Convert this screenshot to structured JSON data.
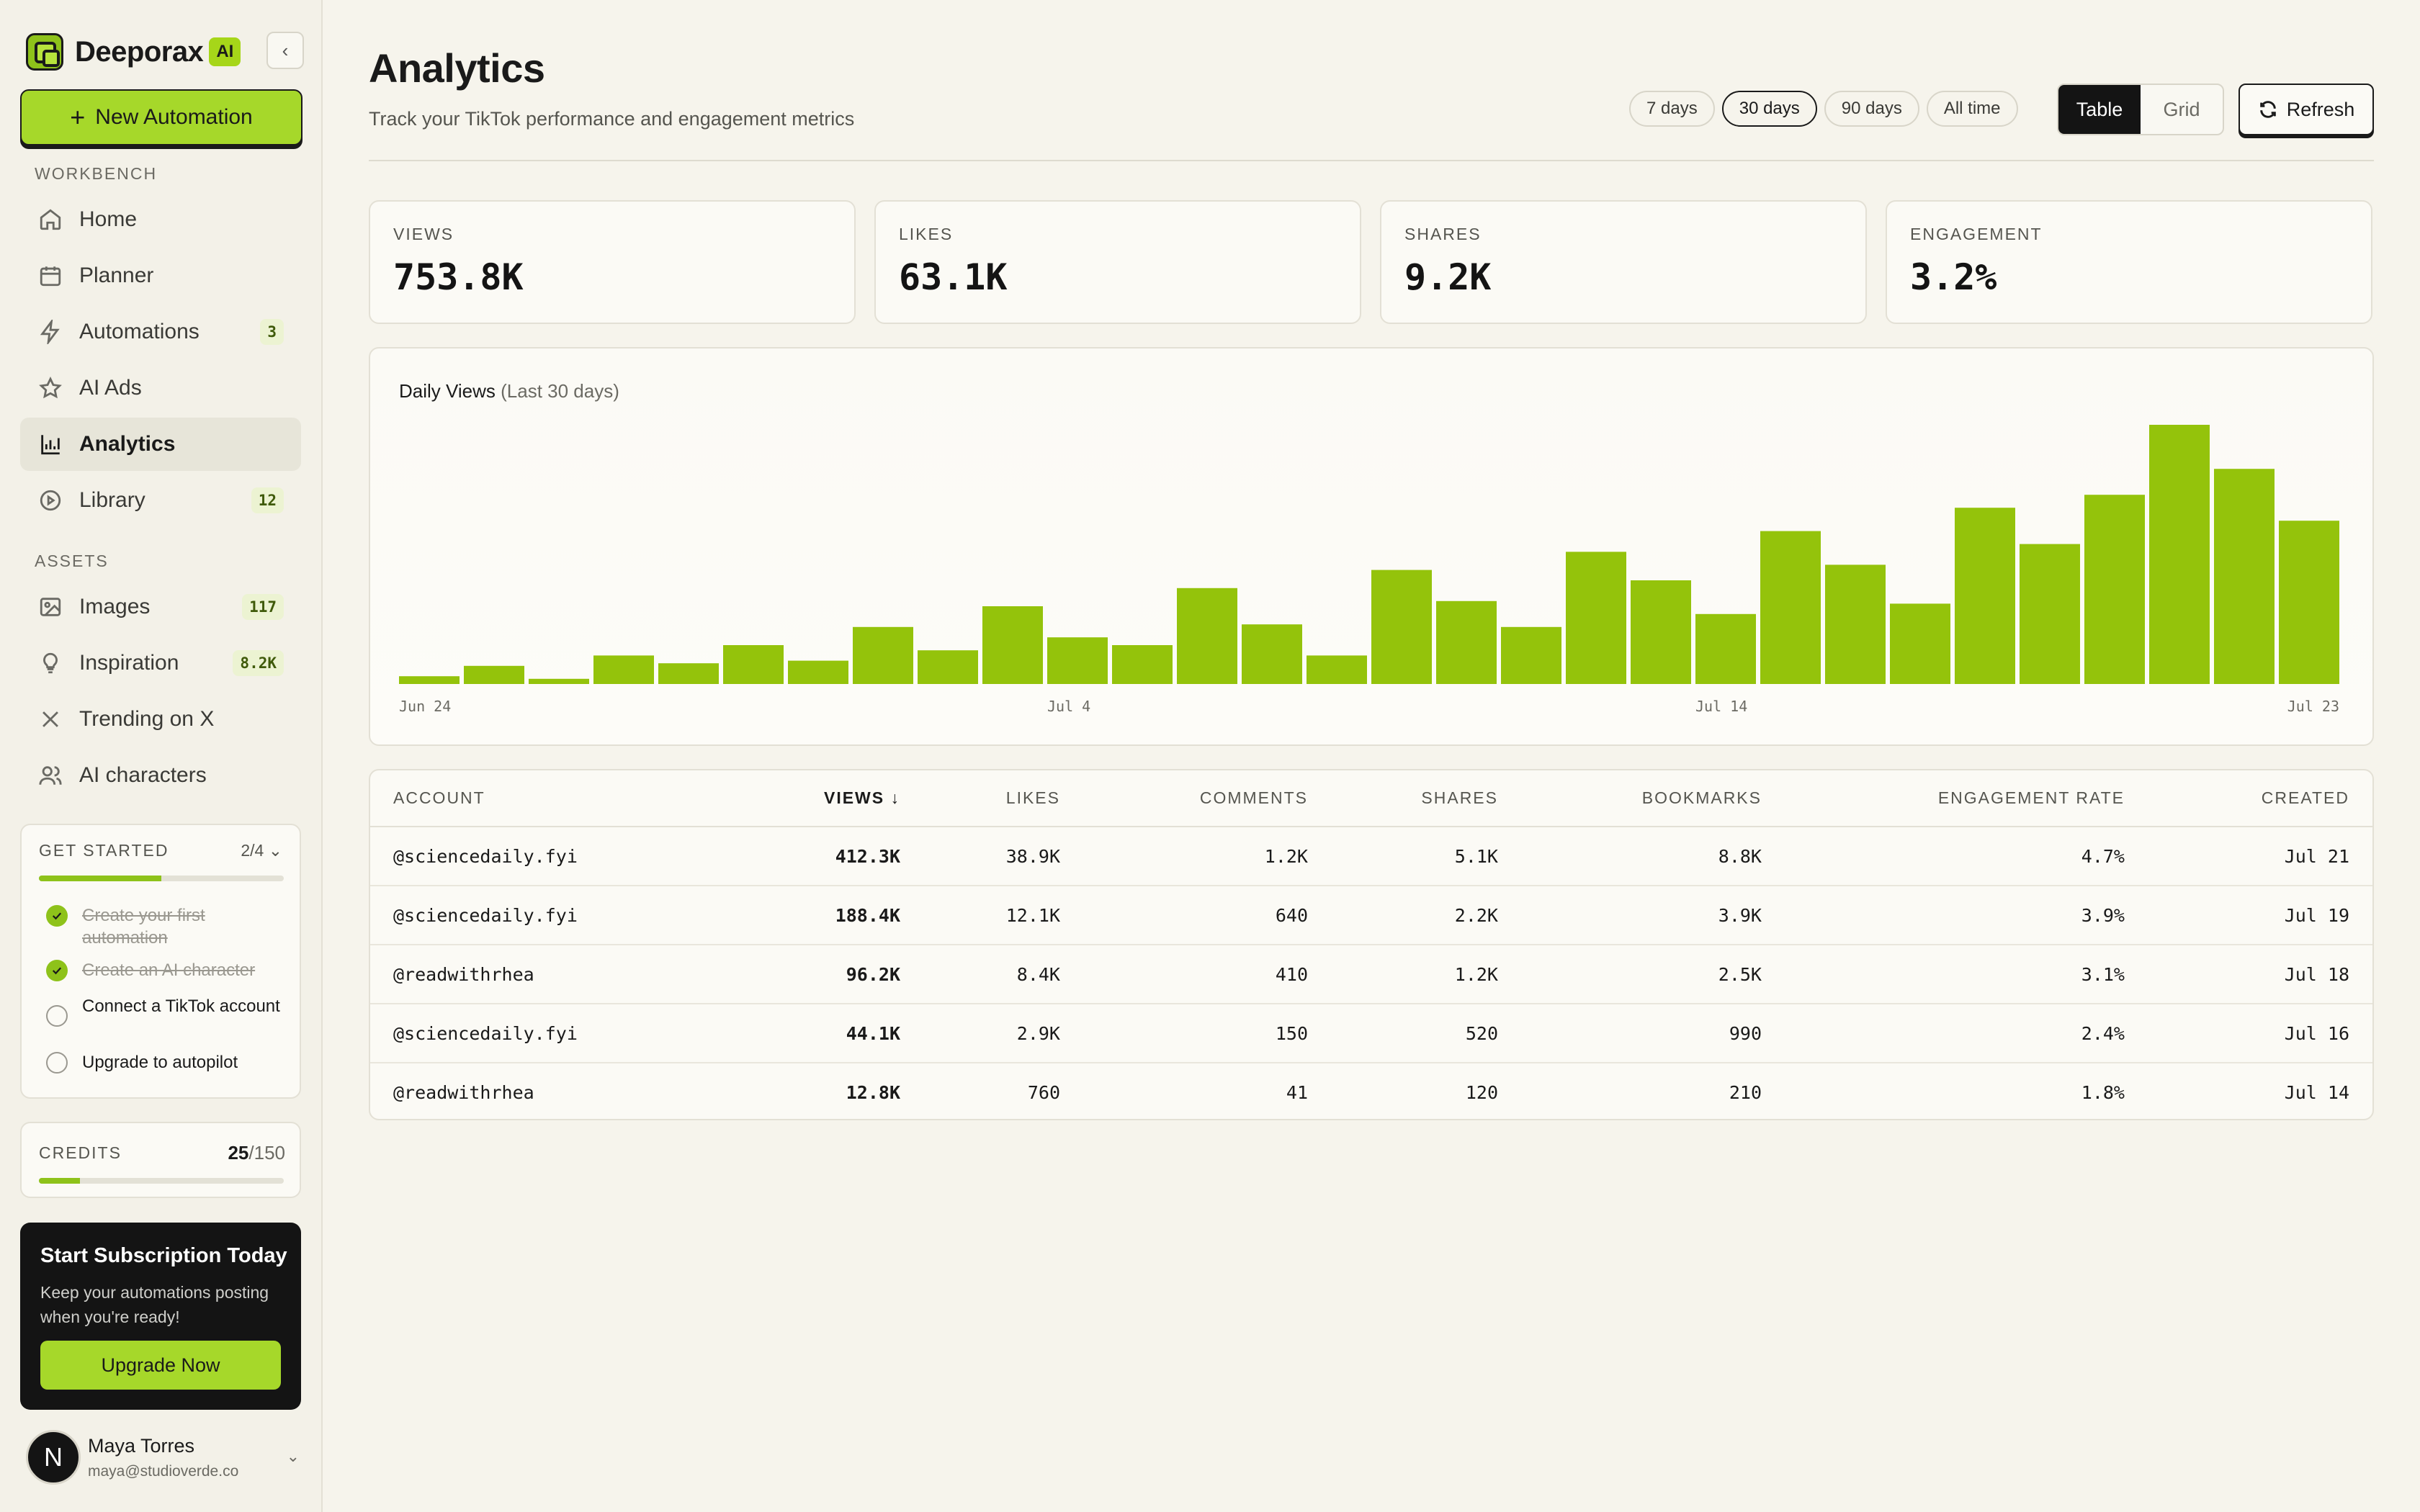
{
  "app": {
    "brand_name": "Deeporax",
    "brand_badge": "AI",
    "new_automation_label": "New Automation"
  },
  "sidebar": {
    "workbench_label": "WORKBENCH",
    "assets_label": "ASSETS",
    "workbench_items": [
      {
        "label": "Home",
        "icon": "home-icon"
      },
      {
        "label": "Planner",
        "icon": "calendar-icon"
      },
      {
        "label": "Automations",
        "icon": "lightning-icon",
        "count": "3"
      },
      {
        "label": "AI Ads",
        "icon": "star-icon"
      },
      {
        "label": "Analytics",
        "icon": "bar-chart-icon",
        "active": true
      },
      {
        "label": "Library",
        "icon": "play-circle-icon",
        "count": "12"
      }
    ],
    "asset_items": [
      {
        "label": "Images",
        "icon": "image-icon",
        "count": "117"
      },
      {
        "label": "Inspiration",
        "icon": "lightbulb-icon",
        "count": "8.2K"
      },
      {
        "label": "Trending on X",
        "icon": "x-icon"
      },
      {
        "label": "AI characters",
        "icon": "users-icon"
      }
    ],
    "get_started": {
      "title": "GET STARTED",
      "progress_text": "2/4",
      "progress_fraction": 0.5,
      "tasks": [
        {
          "label": "Create your first automation",
          "done": true
        },
        {
          "label": "Create an AI character",
          "done": true
        },
        {
          "label": "Connect a TikTok account",
          "done": false
        },
        {
          "label": "Upgrade to autopilot",
          "done": false
        }
      ]
    },
    "credits": {
      "label": "CREDITS",
      "used": "25",
      "total": "/150",
      "fraction": 0.167
    },
    "subscription": {
      "title": "Start Subscription Today",
      "text": "Keep your automations posting when you're ready!",
      "button": "Upgrade Now"
    },
    "user": {
      "initial": "N",
      "name": "Maya Torres",
      "email": "maya@studioverde.co"
    }
  },
  "header": {
    "title": "Analytics",
    "subtitle": "Track your TikTok performance and engagement metrics",
    "ranges": [
      "7 days",
      "30 days",
      "90 days",
      "All time"
    ],
    "active_range": "30 days",
    "view_table": "Table",
    "view_grid": "Grid",
    "active_view": "Table",
    "refresh_label": "Refresh"
  },
  "stats": [
    {
      "label": "VIEWS",
      "value": "753.8K"
    },
    {
      "label": "LIKES",
      "value": "63.1K"
    },
    {
      "label": "SHARES",
      "value": "9.2K"
    },
    {
      "label": "ENGAGEMENT",
      "value": "3.2%"
    }
  ],
  "chart_title": "Daily Views",
  "chart_subtitle": "(Last 30 days)",
  "colors": {
    "accent": "#8ec21a",
    "bar": "#94c30b",
    "dark": "#141414"
  },
  "chart_data": {
    "type": "bar",
    "title": "Daily Views",
    "subtitle": "(Last 30 days)",
    "tick_labels": [
      "Jun 24",
      "Jul 4",
      "Jul 14",
      "Jul 23"
    ],
    "tick_indices": [
      0,
      10,
      20,
      29
    ],
    "values": [
      3,
      7,
      2,
      11,
      8,
      15,
      9,
      22,
      13,
      30,
      18,
      15,
      37,
      23,
      11,
      44,
      32,
      22,
      51,
      40,
      27,
      59,
      46,
      31,
      68,
      54,
      73,
      100,
      83,
      63
    ],
    "ylim": [
      0,
      100
    ],
    "grid": false,
    "legend": "none"
  },
  "table": {
    "columns": [
      "ACCOUNT",
      "VIEWS ↓",
      "LIKES",
      "COMMENTS",
      "SHARES",
      "BOOKMARKS",
      "ENGAGEMENT RATE",
      "CREATED"
    ],
    "rows": [
      [
        "@sciencedaily.fyi",
        "412.3K",
        "38.9K",
        "1.2K",
        "5.1K",
        "8.8K",
        "4.7%",
        "Jul 21"
      ],
      [
        "@sciencedaily.fyi",
        "188.4K",
        "12.1K",
        "640",
        "2.2K",
        "3.9K",
        "3.9%",
        "Jul 19"
      ],
      [
        "@readwithrhea",
        "96.2K",
        "8.4K",
        "410",
        "1.2K",
        "2.5K",
        "3.1%",
        "Jul 18"
      ],
      [
        "@sciencedaily.fyi",
        "44.1K",
        "2.9K",
        "150",
        "520",
        "990",
        "2.4%",
        "Jul 16"
      ],
      [
        "@readwithrhea",
        "12.8K",
        "760",
        "41",
        "120",
        "210",
        "1.8%",
        "Jul 14"
      ]
    ]
  }
}
